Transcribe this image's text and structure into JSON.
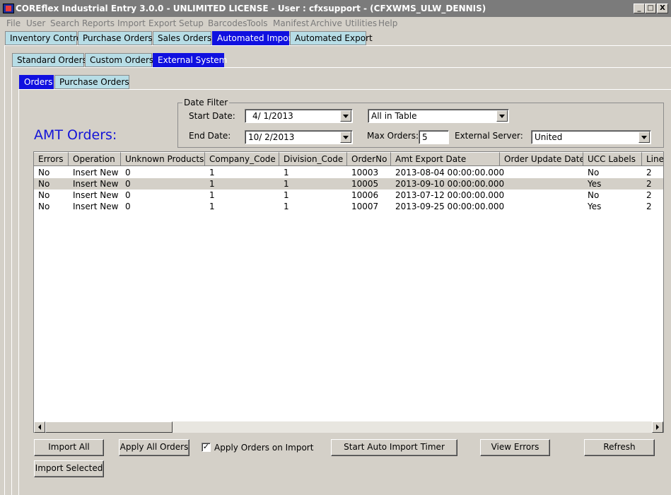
{
  "window": {
    "title": "COREflex Industrial Entry 3.0.0 - UNLIMITED LICENSE - User : cfxsupport - (CFXWMS_ULW_DENNIS)",
    "minimize_label": "_",
    "maximize_label": "□",
    "close_label": "X"
  },
  "menu": [
    "File",
    "User",
    "Search",
    "Reports",
    "Import",
    "Export",
    "Setup",
    "Barcodes",
    "Tools",
    "Manifest",
    "Archive",
    "Utilities",
    "Help"
  ],
  "main_tabs": [
    "Inventory Control",
    "Purchase Orders",
    "Sales Orders",
    "Automated Import",
    "Automated Export"
  ],
  "sub_tabs": [
    "Standard Orders",
    "Custom Orders",
    "External System"
  ],
  "inner_tabs": [
    "Orders",
    "Purchase Orders"
  ],
  "date_filter": {
    "legend": "Date Filter",
    "start_label": "Start Date:",
    "start_value": "4/  1/2013",
    "end_label": "End Date:",
    "end_value": "10/  2/2013",
    "scope_value": "All in Table",
    "max_orders_label": "Max Orders:",
    "max_orders_value": "5",
    "server_label": "External Server:",
    "server_value": "United"
  },
  "section_title": "AMT Orders:",
  "grid": {
    "columns": [
      "Errors",
      "Operation",
      "Unknown Products",
      "Company_Code",
      "Division_Code",
      "OrderNo",
      "Amt Export Date",
      "Order Update Date",
      "UCC Labels",
      "Line"
    ],
    "rows": [
      [
        "No",
        "Insert New",
        "0",
        "1",
        "1",
        "10003",
        "2013-08-04 00:00:00.000",
        "",
        "No",
        "2"
      ],
      [
        "No",
        "Insert New",
        "0",
        "1",
        "1",
        "10005",
        "2013-09-10 00:00:00.000",
        "",
        "Yes",
        "2"
      ],
      [
        "No",
        "Insert New",
        "0",
        "1",
        "1",
        "10006",
        "2013-07-12 00:00:00.000",
        "",
        "No",
        "2"
      ],
      [
        "No",
        "Insert New",
        "0",
        "1",
        "1",
        "10007",
        "2013-09-25 00:00:00.000",
        "",
        "Yes",
        "2"
      ]
    ]
  },
  "buttons": {
    "import_all": "Import All",
    "apply_all": "Apply All Orders",
    "apply_on_import": "Apply Orders on Import",
    "apply_on_import_checked": "✓",
    "start_timer": "Start Auto Import Timer",
    "view_errors": "View Errors",
    "refresh": "Refresh",
    "import_selected": "Import Selected"
  },
  "colors": {
    "active_tab": "#1010e0",
    "inactive_tab": "#b7dde6",
    "section_title": "#1414d8"
  }
}
